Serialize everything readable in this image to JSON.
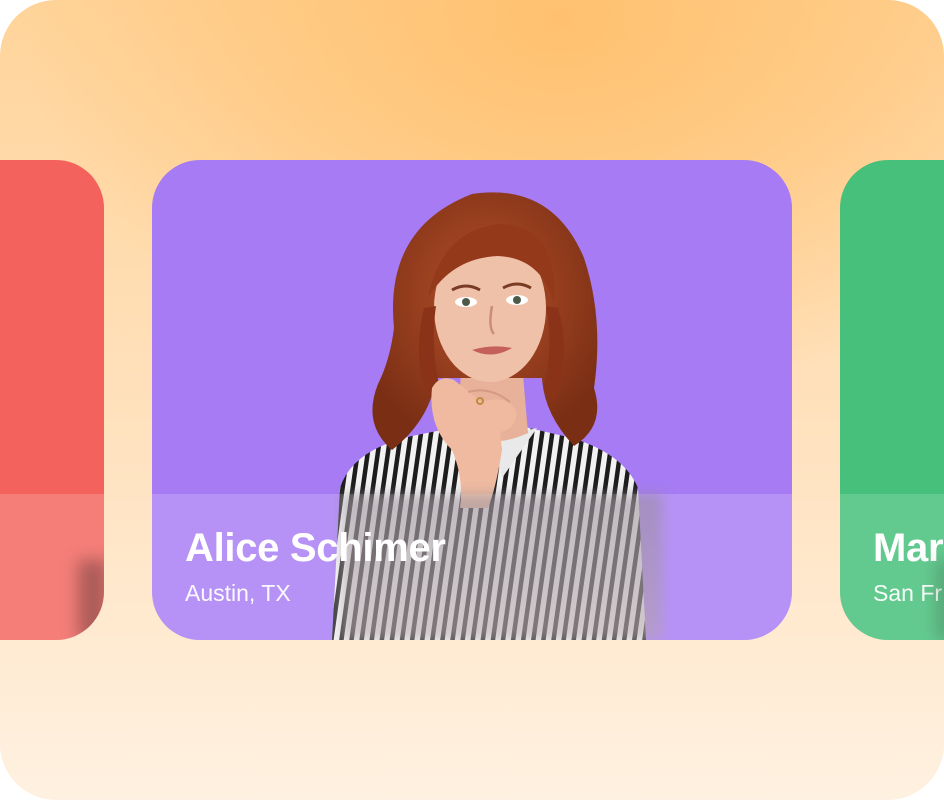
{
  "carousel": {
    "cards": [
      {
        "position": "previous",
        "accent": "#f3625c",
        "name": "",
        "location": ""
      },
      {
        "position": "current",
        "accent": "#a67bf4",
        "name": "Alice Schimer",
        "location": "Austin, TX",
        "photo_icon": "person-portrait-icon"
      },
      {
        "position": "next",
        "accent": "#46c07a",
        "name": "Mar",
        "location": "San Fr"
      }
    ]
  },
  "colors": {
    "background_top": "#ffc170",
    "background_bottom": "#fff1e1"
  }
}
